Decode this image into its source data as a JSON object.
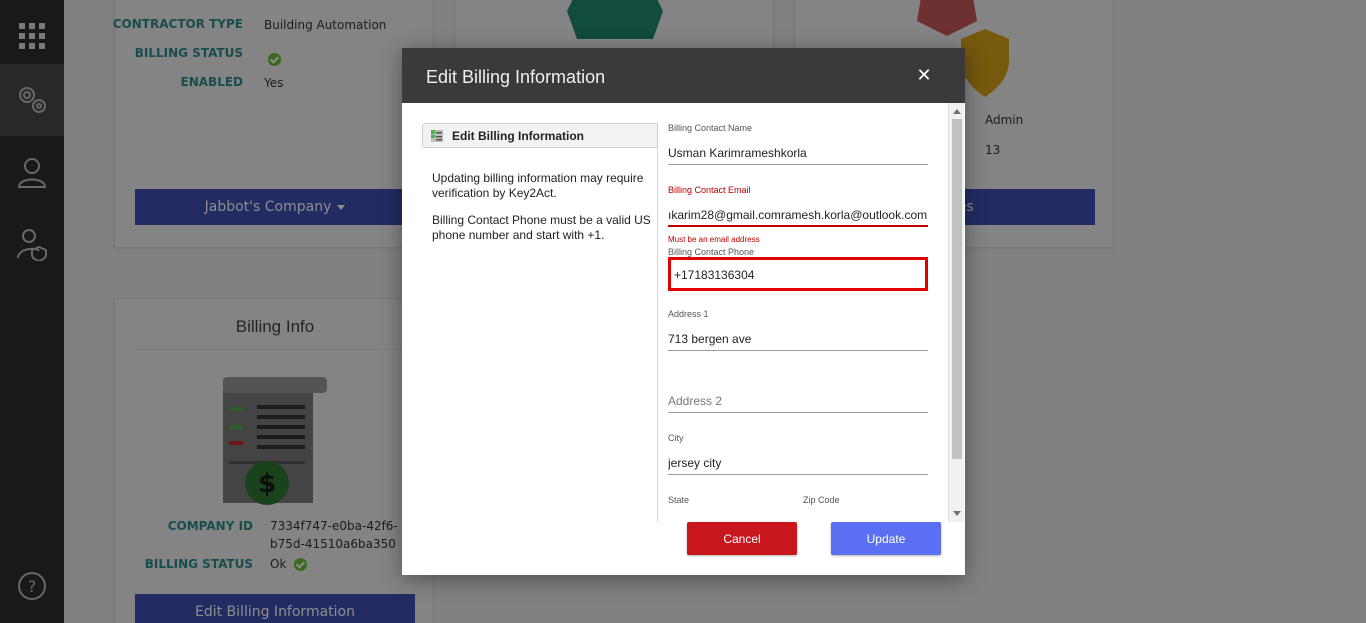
{
  "sidebar": {
    "items": [
      {
        "icon": "apps-grid-icon"
      },
      {
        "icon": "settings-gears-icon"
      },
      {
        "icon": "users-icon"
      },
      {
        "icon": "user-shield-icon"
      },
      {
        "icon": "help-icon"
      }
    ]
  },
  "contractor_card": {
    "contractor_type_label": "CONTRACTOR TYPE",
    "contractor_type_value": "Building Automation",
    "billing_status_label": "BILLING STATUS",
    "enabled_label": "ENABLED",
    "enabled_value": "Yes",
    "company_button": "Jabbot's Company"
  },
  "roles_card": {
    "role_name": "Admin",
    "role_count": "13",
    "button": "Roles"
  },
  "billing_card": {
    "title": "Billing Info",
    "company_id_label": "COMPANY ID",
    "company_id_value_line1": "7334f747-e0ba-42f6-",
    "company_id_value_line2": "b75d-41510a6ba350",
    "billing_status_label": "BILLING STATUS",
    "billing_status_value": "Ok",
    "edit_button": "Edit Billing Information"
  },
  "modal": {
    "title": "Edit Billing Information",
    "close": "✕",
    "panel_title": "Edit Billing Information",
    "info_line_1": "Updating billing information may require verification by Key2Act.",
    "info_line_2": "Billing Contact Phone must be a valid US phone number and start with +1.",
    "fields": {
      "contact_name_label": "Billing Contact Name",
      "contact_name_value": "Usman Karimrameshkorla",
      "contact_email_label": "Billing Contact Email",
      "contact_email_value": "ıkarim28@gmail.comramesh.korla@outlook.com",
      "contact_email_error": "Must be an email address",
      "contact_phone_label": "Billing Contact Phone",
      "contact_phone_value": "+17183136304",
      "address1_label": "Address 1",
      "address1_value": "713 bergen ave",
      "address2_placeholder": "Address 2",
      "city_label": "City",
      "city_value": "jersey city",
      "state_label": "State",
      "zip_label": "Zip Code"
    },
    "cancel_button": "Cancel",
    "update_button": "Update"
  },
  "colors": {
    "sidebar_bg": "#2e2e2e",
    "accent_blue": "#3f51b5",
    "label_teal": "#2a8f8a",
    "error_red": "#c00000",
    "cancel_red": "#c8161d",
    "update_blue": "#5a6ff2"
  }
}
